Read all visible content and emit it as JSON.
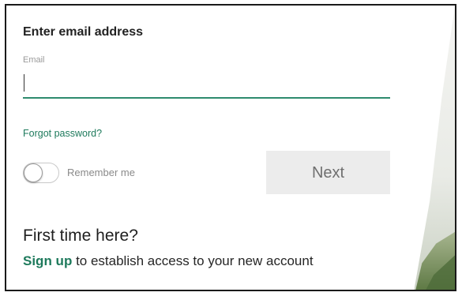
{
  "form": {
    "title": "Enter email address",
    "email_label": "Email",
    "email_value": "",
    "forgot_password": "Forgot password?",
    "remember_me": "Remember me",
    "remember_me_checked": false,
    "next_button": "Next"
  },
  "signup": {
    "heading": "First time here?",
    "link_text": "Sign up",
    "rest_text": "to establish access to your new account"
  },
  "colors": {
    "accent": "#1e7a5c",
    "input_underline": "#2e8b6e",
    "button_bg": "#ececec"
  }
}
